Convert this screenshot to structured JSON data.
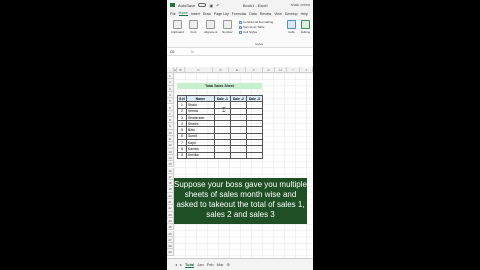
{
  "titlebar": {
    "autosave": "AutoSave",
    "title": "Book1 - Excel",
    "user": "shalu verma"
  },
  "menu": {
    "tabs": [
      "File",
      "Home",
      "Insert",
      "Draw",
      "Page Lay",
      "Formulas",
      "Data",
      "Review",
      "View",
      "Develop",
      "Help"
    ]
  },
  "ribbon": {
    "clipboard": "Clipboard",
    "font": "Font",
    "alignment": "Alignment",
    "number": "Number",
    "conditional_formatting": "Conditional Formatting",
    "format_as_table": "Format as Table",
    "cell_styles": "Cell Styles",
    "styles": "Styles",
    "cells": "Cells",
    "editing": "Editing"
  },
  "formula_bar": {
    "namebox": "D5",
    "fx": "fx"
  },
  "columns": [
    "A",
    "B",
    "C",
    "D",
    "E",
    "F",
    "G",
    "H",
    "I",
    "J",
    "K",
    "L"
  ],
  "rows": [
    "1",
    "2",
    "3",
    "4",
    "5",
    "6",
    "7",
    "8",
    "9",
    "10",
    "11",
    "12",
    "13",
    "14",
    "15",
    "16",
    "17",
    "18",
    "19",
    "20",
    "21",
    "22",
    "23",
    "24",
    "25",
    "26",
    "27",
    "28",
    "29"
  ],
  "sheet_title": "Total Sales Sheet",
  "table": {
    "headers": [
      "S.N",
      "Name",
      "Sale -1",
      "Sale -2",
      "Sale -3"
    ],
    "rows": [
      [
        "1",
        "Shalu"
      ],
      [
        "2",
        "Verma"
      ],
      [
        "3",
        "Shailender"
      ],
      [
        "4",
        "Shalini"
      ],
      [
        "5",
        "Bittu"
      ],
      [
        "6",
        "Sumit"
      ],
      [
        "7",
        "Kajol"
      ],
      [
        "8",
        "Kanika"
      ],
      [
        "9",
        "Annika"
      ]
    ]
  },
  "sheet_tabs": [
    "Total",
    "Jan",
    "Feb",
    "Mar"
  ],
  "caption": "Suppose your boss gave you multiple sheets of sales month wise and asked to takeout the total of sales 1, sales 2 and sales 3"
}
